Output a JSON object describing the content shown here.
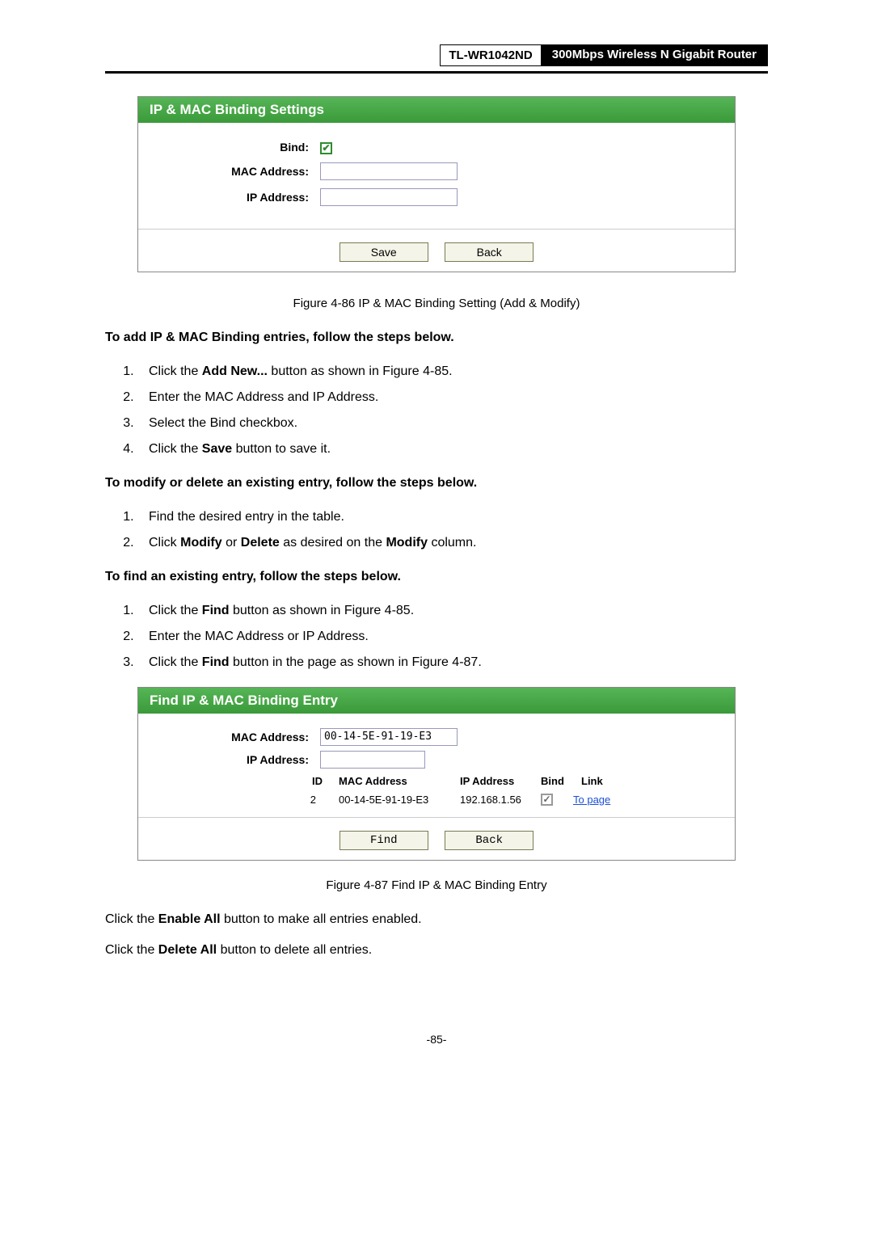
{
  "header": {
    "model": "TL-WR1042ND",
    "desc": "300Mbps Wireless N Gigabit Router"
  },
  "fig1": {
    "title": "IP & MAC Binding Settings",
    "bind_label": "Bind:",
    "mac_label": "MAC Address:",
    "ip_label": "IP Address:",
    "save_label": "Save",
    "back_label": "Back",
    "caption": "Figure 4-86   IP & MAC Binding Setting (Add & Modify)"
  },
  "section_add": {
    "heading": "To add IP & MAC Binding entries, follow the steps below.",
    "step1_pre": "Click the ",
    "step1_bold": "Add New...",
    "step1_post": " button as shown in Figure 4-85.",
    "step2": "Enter the MAC Address and IP Address.",
    "step3": "Select the Bind checkbox.",
    "step4_pre": "Click the ",
    "step4_bold": "Save",
    "step4_post": " button to save it."
  },
  "section_modify": {
    "heading": "To modify or delete an existing entry, follow the steps below.",
    "step1": "Find the desired entry in the table.",
    "step2_pre": "Click ",
    "step2_b1": "Modify",
    "step2_mid": " or ",
    "step2_b2": "Delete",
    "step2_post1": " as desired on the ",
    "step2_b3": "Modify",
    "step2_post2": " column."
  },
  "section_find": {
    "heading": "To find an existing entry, follow the steps below.",
    "step1_pre": "Click the ",
    "step1_bold": "Find",
    "step1_post": " button as shown in Figure 4-85.",
    "step2": "Enter the MAC Address or IP Address.",
    "step3_pre": "Click the ",
    "step3_bold": "Find",
    "step3_post": " button in the page as shown in Figure 4-87."
  },
  "fig2": {
    "title": "Find IP & MAC Binding Entry",
    "mac_label": "MAC Address:",
    "ip_label": "IP Address:",
    "mac_value": "00-14-5E-91-19-E3",
    "col_id": "ID",
    "col_mac": "MAC Address",
    "col_ip": "IP Address",
    "col_bind": "Bind",
    "col_link": "Link",
    "row_id": "2",
    "row_mac": "00-14-5E-91-19-E3",
    "row_ip": "192.168.1.56",
    "row_link": "To page",
    "find_label": "Find",
    "back_label": "Back",
    "caption": "Figure 4-87   Find IP & MAC Binding Entry"
  },
  "footer": {
    "line1_pre": "Click the ",
    "line1_bold": "Enable All",
    "line1_post": " button to make all entries enabled.",
    "line2_pre": "Click the ",
    "line2_bold": "Delete All",
    "line2_post": " button to delete all entries.",
    "page_num": "-85-"
  }
}
